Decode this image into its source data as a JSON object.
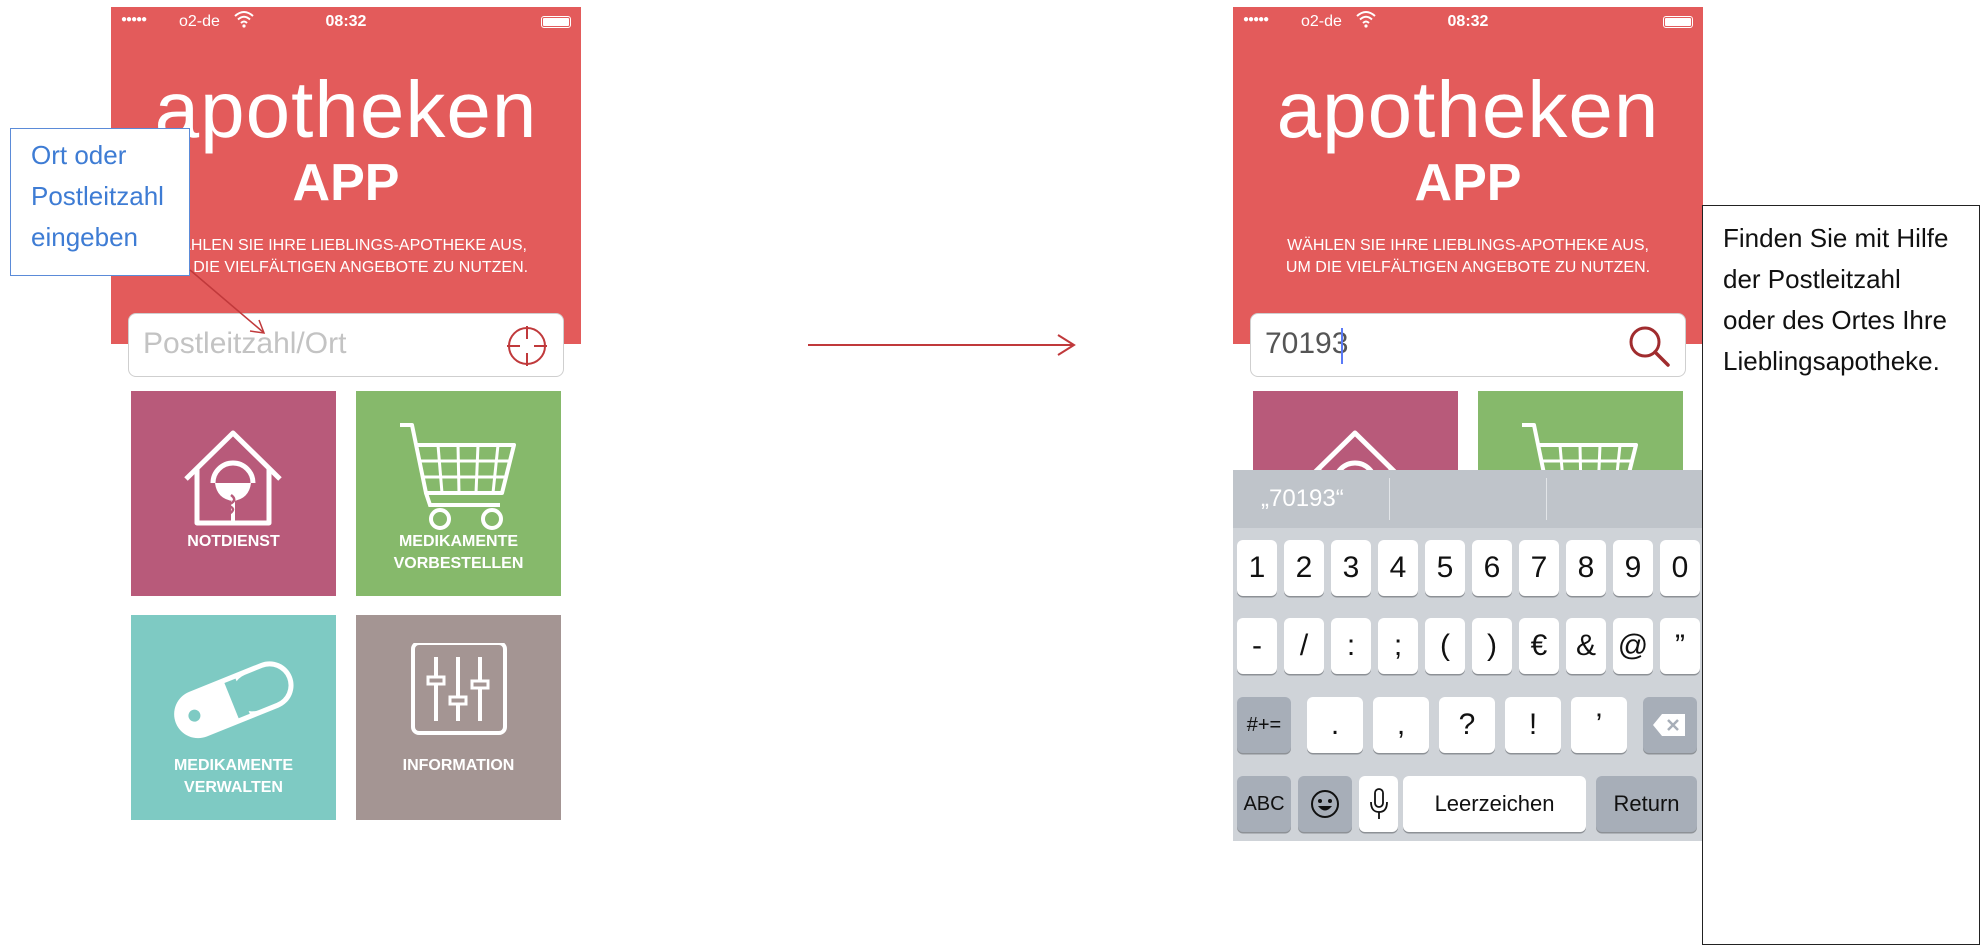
{
  "left_phone": {
    "status": {
      "signal": "●●●●●",
      "carrier": "o2-de",
      "time": "08:32"
    },
    "brand": {
      "title": "apotheken",
      "subtitle": "APP"
    },
    "tagline": [
      "WÄHLEN SIE IHRE LIEBLINGS-APOTHEKE AUS,",
      "UM DIE VIELFÄLTIGEN ANGEBOTE ZU NUTZEN."
    ],
    "search": {
      "placeholder": "Postleitzahl/Ort",
      "value": ""
    },
    "tiles": [
      {
        "label_lines": [
          "NOTDIENST"
        ],
        "icon": "pharmacy-house-icon",
        "color": "#b85a7a"
      },
      {
        "label_lines": [
          "MEDIKAMENTE",
          "VORBESTELLEN"
        ],
        "icon": "cart-icon",
        "color": "#86b96b"
      },
      {
        "label_lines": [
          "MEDIKAMENTE",
          "VERWALTEN"
        ],
        "icon": "pill-icon",
        "color": "#7ecac3"
      },
      {
        "label_lines": [
          "INFORMATION"
        ],
        "icon": "sliders-icon",
        "color": "#a49593"
      }
    ]
  },
  "callout": {
    "lines": [
      "Ort oder",
      "Postleitzahl",
      "eingeben"
    ]
  },
  "right_phone": {
    "status": {
      "signal": "●●●●●",
      "carrier": "o2-de",
      "time": "08:32"
    },
    "brand": {
      "title": "apotheken",
      "subtitle": "APP"
    },
    "tagline": [
      "WÄHLEN SIE IHRE LIEBLINGS-APOTHEKE AUS,",
      "UM DIE VIELFÄLTIGEN ANGEBOTE ZU NUTZEN."
    ],
    "search": {
      "value": "70193"
    },
    "suggestion": "„70193“",
    "keyboard": {
      "row1": [
        "1",
        "2",
        "3",
        "4",
        "5",
        "6",
        "7",
        "8",
        "9",
        "0"
      ],
      "row2": [
        "-",
        "/",
        ":",
        ";",
        "(",
        ")",
        "€",
        "&",
        "@",
        "”"
      ],
      "row3_left": "#+=",
      "row3": [
        ".",
        ",",
        "?",
        "!",
        "’"
      ],
      "row4": {
        "abc": "ABC",
        "space": "Leerzeichen",
        "return": "Return"
      }
    }
  },
  "note": {
    "lines": [
      "Finden Sie mit Hilfe",
      "der Postleitzahl",
      "oder des Ortes Ihre",
      "Lieblingsapotheke."
    ]
  },
  "colors": {
    "brand_red": "#e35b5b",
    "callout_blue": "#3e7cd4",
    "arrow_red": "#c0393b"
  }
}
